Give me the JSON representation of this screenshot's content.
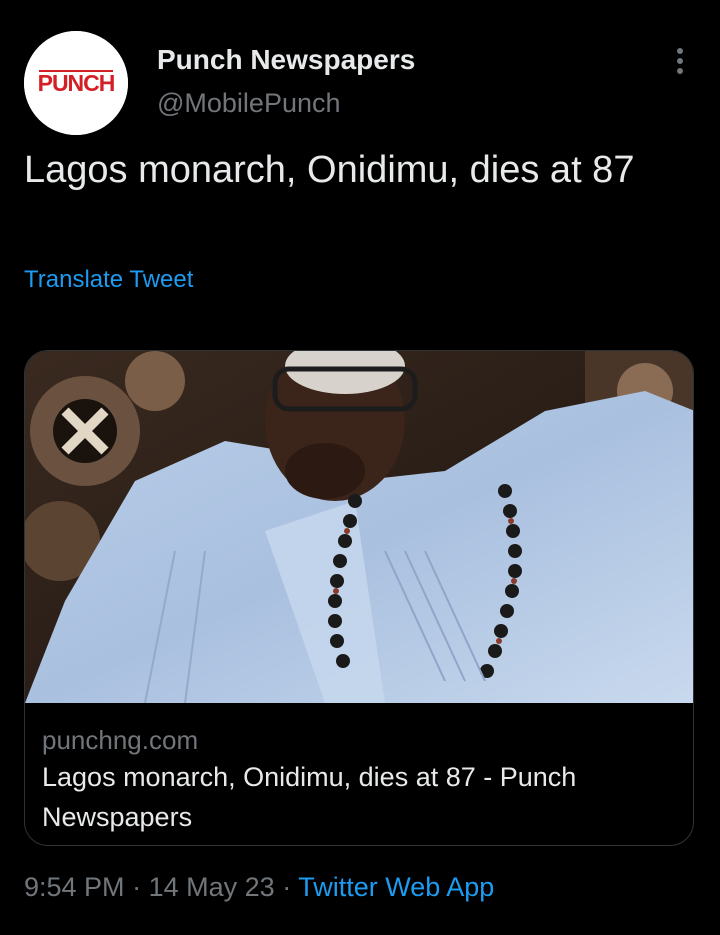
{
  "author": {
    "name": "Punch Newspapers",
    "handle": "@MobilePunch",
    "avatar_logo_text": "PUNCH"
  },
  "tweet": {
    "text": "Lagos monarch, Onidimu, dies at 87",
    "translate_label": "Translate Tweet"
  },
  "card": {
    "domain": "punchng.com",
    "title": "Lagos monarch, Onidimu, dies at 87 - Punch Newspapers"
  },
  "meta": {
    "time": "9:54 PM",
    "separator": "·",
    "date": "14 May 23",
    "source": "Twitter Web App"
  },
  "icons": {
    "more": "more-options-icon"
  },
  "colors": {
    "background": "#000000",
    "text_primary": "#e7e9ea",
    "text_secondary": "#71767b",
    "link": "#1d9bf0",
    "border": "#2f3336",
    "punch_logo_red": "#d32027"
  }
}
